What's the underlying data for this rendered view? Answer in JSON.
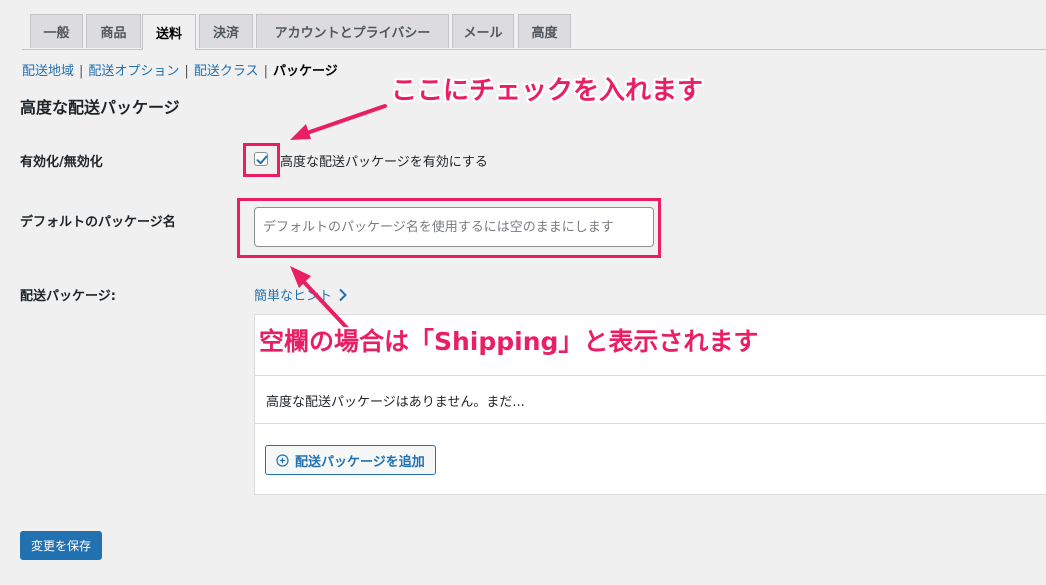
{
  "tabs": [
    "一般",
    "商品",
    "送料",
    "決済",
    "アカウントとプライバシー",
    "メール",
    "高度"
  ],
  "active_tab": "送料",
  "subnav": {
    "zones": "配送地域",
    "options": "配送オプション",
    "classes": "配送クラス",
    "packages": "パッケージ"
  },
  "section_title": "高度な配送パッケージ",
  "enable": {
    "label": "有効化/無効化",
    "checkbox_label": "高度な配送パッケージを有効にする",
    "checked": true
  },
  "default_name": {
    "label": "デフォルトのパッケージ名",
    "value": "",
    "placeholder": "デフォルトのパッケージ名を使用するには空のままにします"
  },
  "packages": {
    "label": "配送パッケージ:",
    "hint_link": "簡単なヒント",
    "empty_text": "高度な配送パッケージはありません。まだ...",
    "add_button": "配送パッケージを追加"
  },
  "save_button": "変更を保存",
  "annotations": {
    "checkbox_note": "ここにチェックを入れます",
    "input_note": "空欄の場合は「Shipping」と表示されます"
  },
  "colors": {
    "annotation": "#e91e63",
    "link": "#2271b1",
    "primary_button": "#2271b1"
  }
}
